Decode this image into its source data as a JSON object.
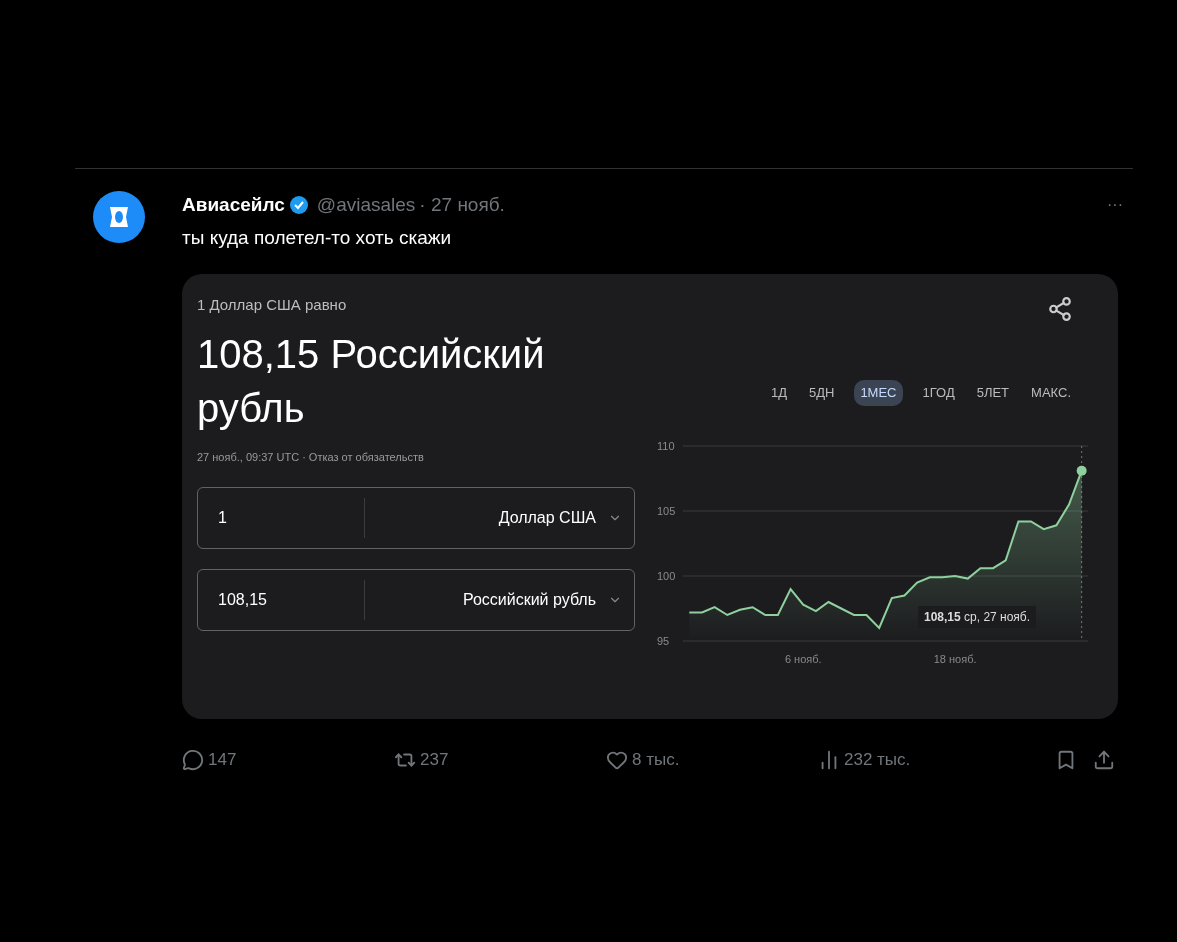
{
  "tweet": {
    "author": "Авиасейлс",
    "verified": true,
    "handle": "@aviasales",
    "date": "· 27 нояб.",
    "more": "···",
    "text": "ты куда полетел-то хоть скажи"
  },
  "converter": {
    "caption": "1 Доллар США равно",
    "result": "108,15 Российский рубль",
    "meta": "27 нояб., 09:37 UTC · Отказ от обязательств",
    "rows": [
      {
        "amount": "1",
        "currency": "Доллар США"
      },
      {
        "amount": "108,15",
        "currency": "Российский рубль"
      }
    ],
    "ranges": [
      {
        "label": "1Д",
        "selected": false
      },
      {
        "label": "5ДН",
        "selected": false
      },
      {
        "label": "1МЕС",
        "selected": true
      },
      {
        "label": "1ГОД",
        "selected": false
      },
      {
        "label": "5ЛЕТ",
        "selected": false
      },
      {
        "label": "МАКС.",
        "selected": false
      }
    ],
    "tooltip": {
      "value": "108,15",
      "date": "ср, 27 нояб."
    },
    "chart_data": {
      "type": "area",
      "categories": [
        null,
        null,
        null,
        null,
        null,
        null,
        null,
        null,
        null,
        "6 нояб.",
        null,
        null,
        null,
        null,
        null,
        null,
        null,
        null,
        null,
        null,
        null,
        "18 нояб.",
        null,
        null,
        null,
        null,
        null,
        null,
        null,
        null,
        null,
        null
      ],
      "series": [
        {
          "color": "#8fd19e",
          "values": [
            97.2,
            97.2,
            97.6,
            97.0,
            97.4,
            97.6,
            97.0,
            97.0,
            99.0,
            97.8,
            97.3,
            98.0,
            97.5,
            97.0,
            97.0,
            96.0,
            98.3,
            98.5,
            99.5,
            99.9,
            99.9,
            100.0,
            99.8,
            100.6,
            100.6,
            101.2,
            104.2,
            104.2,
            103.6,
            103.9,
            105.5,
            108.1
          ]
        }
      ],
      "ylim": [
        95,
        110
      ],
      "yticks": [
        95,
        100,
        105,
        110
      ]
    }
  },
  "actions": [
    {
      "kind": "reply",
      "count": "147"
    },
    {
      "kind": "repost",
      "count": "237"
    },
    {
      "kind": "like",
      "count": "8 тыс."
    },
    {
      "kind": "views",
      "count": "232 тыс."
    },
    {
      "kind": "bookmark"
    },
    {
      "kind": "share"
    }
  ]
}
